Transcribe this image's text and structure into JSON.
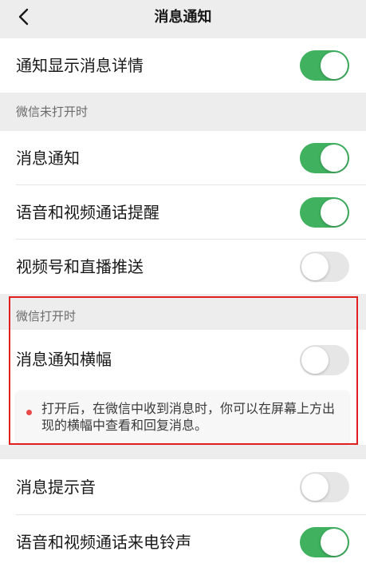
{
  "nav": {
    "title": "消息通知",
    "back_icon": "chevron-left-icon"
  },
  "rows": {
    "show_details": {
      "label": "通知显示消息详情",
      "enabled": true
    },
    "msg_notify": {
      "label": "消息通知",
      "enabled": true
    },
    "call_reminder": {
      "label": "语音和视频通话提醒",
      "enabled": true
    },
    "channels_live": {
      "label": "视频号和直播推送",
      "enabled": false
    },
    "banner": {
      "label": "消息通知横幅",
      "enabled": false
    },
    "sound": {
      "label": "消息提示音",
      "enabled": false
    },
    "ringtone": {
      "label": "语音和视频通话来电铃声",
      "enabled": true
    }
  },
  "sections": {
    "closed": "微信未打开时",
    "open": "微信打开时"
  },
  "tip": {
    "text": "打开后，在微信中收到消息时，你可以在屏幕上方出现的横幅中查看和回复消息。"
  },
  "colors": {
    "toggle_on": "#3fb15f",
    "toggle_off": "#e6e6e6",
    "highlight": "#e02020"
  }
}
